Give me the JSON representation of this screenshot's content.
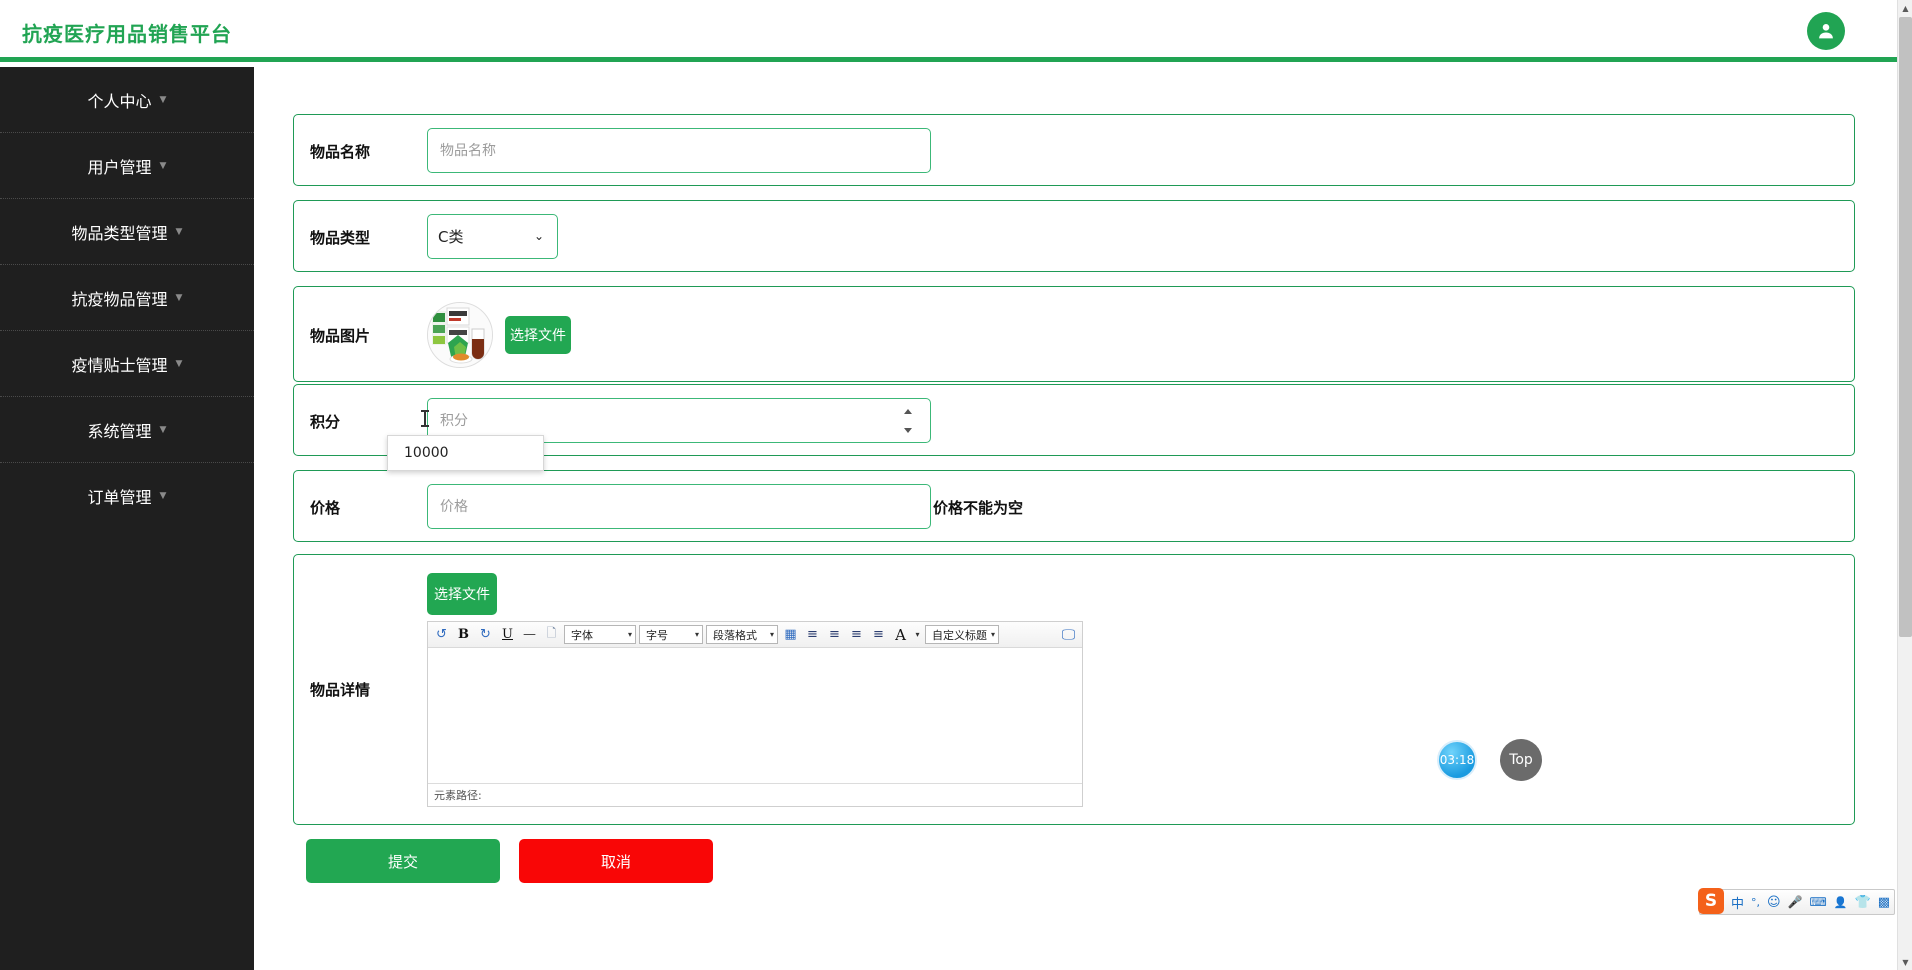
{
  "header": {
    "brand": "抗疫医疗用品销售平台",
    "avatar_icon": "user-icon"
  },
  "sidebar": {
    "items": [
      {
        "label": "个人中心",
        "caret": "▼"
      },
      {
        "label": "用户管理",
        "caret": "▼"
      },
      {
        "label": "物品类型管理",
        "caret": "▼"
      },
      {
        "label": "抗疫物品管理",
        "caret": "▼"
      },
      {
        "label": "疫情贴士管理",
        "caret": "▼"
      },
      {
        "label": "系统管理",
        "caret": "▼"
      },
      {
        "label": "订单管理",
        "caret": "▼"
      }
    ]
  },
  "form": {
    "name_row": {
      "label": "物品名称",
      "placeholder": "物品名称",
      "value": ""
    },
    "type_row": {
      "label": "物品类型",
      "selected": "C类",
      "caret": "⌄",
      "options": [
        "C类"
      ]
    },
    "image_row": {
      "label": "物品图片",
      "button": "选择文件",
      "thumb_alt": "物品图片缩略图"
    },
    "points_row": {
      "label": "积分",
      "placeholder": "积分",
      "value": "",
      "suggestion": "10000"
    },
    "price_row": {
      "label": "价格",
      "placeholder": "价格",
      "value": "",
      "error": "价格不能为空"
    },
    "detail_row": {
      "label": "物品详情",
      "upload_button": "选择文件",
      "editor": {
        "buttons": [
          {
            "name": "undo-icon",
            "glyph": "↺"
          },
          {
            "name": "bold-icon",
            "glyph": "B"
          },
          {
            "name": "redo-icon",
            "glyph": "↻"
          },
          {
            "name": "underline-icon",
            "glyph": "U"
          },
          {
            "name": "horizontal-rule-icon",
            "glyph": "—"
          },
          {
            "name": "page-break-icon",
            "glyph": "🗋"
          }
        ],
        "font_family": "字体",
        "font_size": "字号",
        "paragraph_format": "段落格式",
        "align_buttons": [
          {
            "name": "insert-table-icon",
            "glyph": "▦"
          },
          {
            "name": "align-left-icon",
            "glyph": "≡"
          },
          {
            "name": "align-center-icon",
            "glyph": "≡"
          },
          {
            "name": "align-right-icon",
            "glyph": "≡"
          },
          {
            "name": "align-justify-icon",
            "glyph": "≡"
          }
        ],
        "font_color": "A",
        "custom_title": "自定义标题",
        "fullscreen_icon": "fullscreen-icon",
        "status_text": "元素路径:",
        "content": ""
      }
    },
    "actions": {
      "submit": "提交",
      "cancel": "取消"
    }
  },
  "ime": {
    "logo": "S",
    "items": [
      {
        "name": "chinese-mode-icon",
        "glyph": "中"
      },
      {
        "name": "punctuation-icon",
        "glyph": "°,"
      },
      {
        "name": "emoji-icon",
        "glyph": "☺"
      },
      {
        "name": "voice-input-icon",
        "glyph": "🎤"
      },
      {
        "name": "soft-keyboard-icon",
        "glyph": "⌨"
      },
      {
        "name": "user-center-icon",
        "glyph": "👤"
      },
      {
        "name": "skin-icon",
        "glyph": "👕"
      },
      {
        "name": "toolbox-icon",
        "glyph": "▩"
      }
    ]
  },
  "floating": {
    "timer": "03:18",
    "top_button": "Top"
  },
  "colors": {
    "brand_green": "#21a453",
    "border_green": "#1f9a56",
    "input_green": "#3cb878",
    "cancel_red": "#f90606",
    "sidebar_bg": "#1f1f1f"
  }
}
